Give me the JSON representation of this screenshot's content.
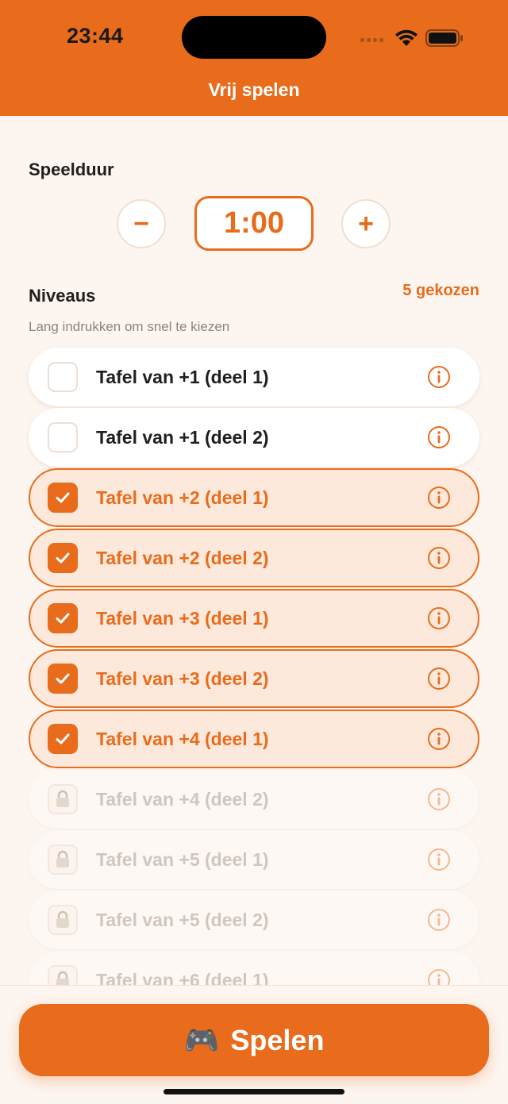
{
  "status_bar": {
    "time": "23:44"
  },
  "header": {
    "title": "Vrij spelen"
  },
  "duration": {
    "title": "Speelduur",
    "value": "1:00",
    "minus_label": "−",
    "plus_label": "+"
  },
  "levels": {
    "title": "Niveaus",
    "chosen_count": "5 gekozen",
    "hint": "Lang indrukken om snel te kiezen",
    "items": [
      {
        "label": "Tafel van +1 (deel 1)",
        "state": "unchecked"
      },
      {
        "label": "Tafel van +1 (deel 2)",
        "state": "unchecked"
      },
      {
        "label": "Tafel van +2 (deel 1)",
        "state": "checked"
      },
      {
        "label": "Tafel van +2 (deel 2)",
        "state": "checked"
      },
      {
        "label": "Tafel van +3 (deel 1)",
        "state": "checked"
      },
      {
        "label": "Tafel van +3 (deel 2)",
        "state": "checked"
      },
      {
        "label": "Tafel van +4 (deel 1)",
        "state": "checked"
      },
      {
        "label": "Tafel van +4 (deel 2)",
        "state": "locked"
      },
      {
        "label": "Tafel van +5 (deel 1)",
        "state": "locked"
      },
      {
        "label": "Tafel van +5 (deel 2)",
        "state": "locked"
      },
      {
        "label": "Tafel van +6 (deel 1)",
        "state": "locked"
      }
    ]
  },
  "play_button": {
    "icon": "🎮",
    "label": "Spelen"
  },
  "colors": {
    "accent": "#e86c1c",
    "background": "#fdf5ef",
    "selected_row": "#fde9db"
  }
}
